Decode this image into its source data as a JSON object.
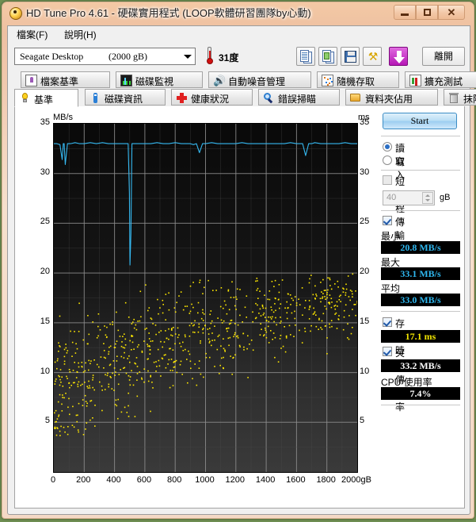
{
  "window": {
    "title": "HD Tune Pro 4.61 - 硬碟實用程式 (LOOP軟體研習團隊by心動)",
    "app_icon": "bulb-icon",
    "controls": {
      "minimize": "–",
      "maximize": "▣",
      "close": "✕"
    }
  },
  "menu": {
    "file": "檔案(F)",
    "help": "說明(H)"
  },
  "toolbar": {
    "drive_name": "Seagate Desktop",
    "drive_capacity": "(2000 gB)",
    "temperature": "31度",
    "buttons": [
      {
        "name": "copy-icon",
        "label": ""
      },
      {
        "name": "copy-image-icon",
        "label": ""
      },
      {
        "name": "save-icon",
        "label": ""
      },
      {
        "name": "settings-icon",
        "label": ""
      },
      {
        "name": "download-icon",
        "label": ""
      }
    ],
    "exit_label": "離開"
  },
  "tabs_top": [
    {
      "label": "檔案基準",
      "icon": "file-benchmark-icon"
    },
    {
      "label": "磁碟監視",
      "icon": "disk-monitor-icon"
    },
    {
      "label": "自動噪音管理",
      "icon": "speaker-icon"
    },
    {
      "label": "隨機存取",
      "icon": "random-access-icon"
    },
    {
      "label": "擴充測試",
      "icon": "extra-tests-icon"
    }
  ],
  "tabs_bottom": [
    {
      "label": "基準",
      "icon": "bulb-icon",
      "active": true
    },
    {
      "label": "磁碟資訊",
      "icon": "info-icon",
      "active": false
    },
    {
      "label": "健康狀況",
      "icon": "health-cross-icon",
      "active": false
    },
    {
      "label": "錯誤掃瞄",
      "icon": "magnifier-icon",
      "active": false
    },
    {
      "label": "資料夾佔用",
      "icon": "folder-icon",
      "active": false
    },
    {
      "label": "抹除",
      "icon": "trash-icon",
      "active": false
    }
  ],
  "panel": {
    "start_label": "Start",
    "mode_read": "讀取",
    "mode_write": "寫入",
    "mode_selected": "讀取",
    "short_stroke_label": "短行程",
    "short_stroke_checked": false,
    "short_stroke_value": "40",
    "short_stroke_unit": "gB",
    "transfer_rate_label": "傳輸率",
    "transfer_rate_checked": true,
    "minimum_label": "最小",
    "minimum_value": "20.8 MB/s",
    "maximum_label": "最大",
    "maximum_value": "33.1 MB/s",
    "average_label": "平均",
    "average_value": "33.0 MB/s",
    "access_time_label": "存取時間",
    "access_time_checked": true,
    "access_time_value": "17.1 ms",
    "burst_rate_label": "突發傳輸率",
    "burst_rate_checked": true,
    "burst_rate_value": "33.2 MB/s",
    "cpu_usage_label": "CPU 使用率",
    "cpu_usage_value": "7.4%"
  },
  "colors": {
    "transfer_curve": "#35b8f0",
    "access_points": "#ffe800",
    "plot_bg": "#0d0d0d",
    "grid": "#8a8a8a",
    "title_bar": "#f3c9a4"
  },
  "chart_data": {
    "type": "line",
    "title": "",
    "ylabel_left": "MB/s",
    "ylabel_right": "ms",
    "xlabel": "gB",
    "xlim": [
      0,
      2000
    ],
    "ylim_left": [
      0,
      35
    ],
    "ylim_right": [
      0,
      35
    ],
    "yticks_left": [
      5,
      10,
      15,
      20,
      25,
      30,
      35
    ],
    "yticks_right": [
      5,
      10,
      15,
      20,
      25,
      30,
      35
    ],
    "xticks": [
      0,
      200,
      400,
      600,
      800,
      1000,
      1200,
      1400,
      1600,
      1800,
      2000
    ],
    "xtick_labels": [
      "0",
      "200",
      "400",
      "600",
      "800",
      "1000",
      "1200",
      "1400",
      "1600",
      "1800",
      "2000gB"
    ],
    "grid": true,
    "legend": "none",
    "series": [
      {
        "name": "傳輸率",
        "type": "line",
        "color": "#35b8f0",
        "unit": "MB/s",
        "x": [
          0,
          20,
          40,
          55,
          62,
          68,
          75,
          90,
          110,
          140,
          170,
          200,
          240,
          280,
          320,
          360,
          400,
          440,
          470,
          490,
          498,
          502,
          508,
          515,
          530,
          560,
          600,
          640,
          680,
          720,
          760,
          800,
          840,
          880,
          900,
          920,
          940,
          960,
          980,
          1000,
          1040,
          1080,
          1120,
          1160,
          1200,
          1240,
          1280,
          1320,
          1360,
          1400,
          1440,
          1480,
          1520,
          1560,
          1600,
          1640,
          1660,
          1680,
          1700,
          1720,
          1760,
          1800,
          1840,
          1880,
          1920,
          1960,
          2000
        ],
        "y": [
          33.0,
          33.0,
          32.9,
          31.4,
          33.0,
          33.0,
          30.9,
          33.0,
          33.0,
          33.1,
          33.0,
          33.0,
          33.1,
          33.0,
          33.1,
          33.0,
          33.0,
          33.0,
          33.0,
          33.0,
          28.0,
          20.8,
          24.0,
          33.0,
          33.0,
          33.0,
          33.0,
          33.0,
          33.1,
          33.0,
          33.0,
          33.1,
          33.0,
          33.0,
          33.0,
          32.9,
          33.0,
          32.1,
          33.0,
          33.0,
          33.1,
          33.0,
          33.0,
          33.0,
          33.0,
          33.1,
          33.0,
          33.0,
          33.0,
          33.0,
          33.0,
          33.0,
          33.0,
          33.1,
          33.0,
          33.0,
          31.8,
          33.0,
          33.0,
          33.1,
          33.0,
          33.0,
          33.0,
          33.0,
          33.1,
          33.0,
          33.0
        ]
      },
      {
        "name": "存取時間",
        "type": "scatter",
        "color": "#ffe800",
        "unit": "ms",
        "description": "Access time samples rise from ~5 ms near LBA 0 to ~19 ms near the end of the drive; dense cloud between 8 and 19 ms."
      }
    ],
    "summary": {
      "minimum_mbs": 20.8,
      "maximum_mbs": 33.1,
      "average_mbs": 33.0,
      "access_time_ms": 17.1,
      "burst_rate_mbs": 33.2,
      "cpu_usage_percent": 7.4
    }
  }
}
